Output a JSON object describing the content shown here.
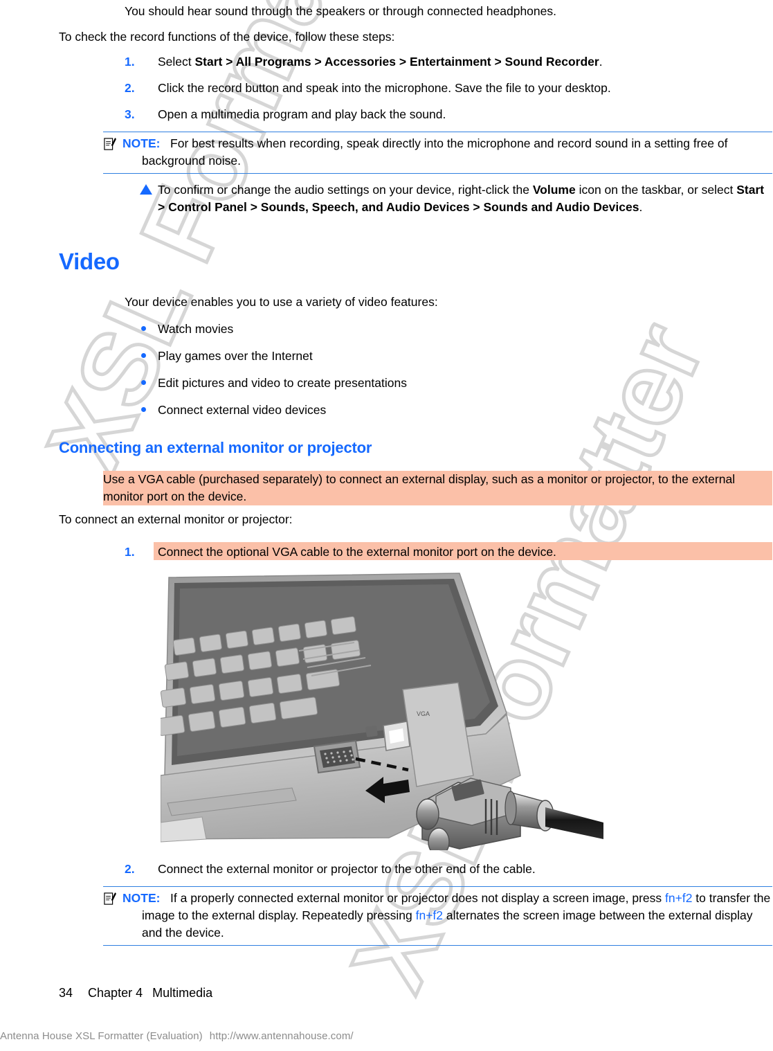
{
  "document": {
    "intro_line": "You should hear sound through the speakers or through connected headphones.",
    "record_steps_lead": "To check the record functions of the device, follow these steps:"
  },
  "record_steps": [
    {
      "num": "1.",
      "pre": "Select ",
      "bold": "Start > All Programs > Accessories > Entertainment > Sound Recorder",
      "post": "."
    },
    {
      "num": "2.",
      "pre": "Click the record button and speak into the microphone. Save the file to your desktop.",
      "bold": "",
      "post": ""
    },
    {
      "num": "3.",
      "pre": "Open a multimedia program and play back the sound.",
      "bold": "",
      "post": ""
    }
  ],
  "note_record": {
    "icon": "note-pencil-icon",
    "label": "NOTE:",
    "text": "For best results when recording, speak directly into the microphone and record sound in a setting free of background noise."
  },
  "audio_settings_step": {
    "bullet": "triangle-bullet",
    "part1": "To confirm or change the audio settings on your device, right-click the ",
    "bold1": "Volume",
    "part2": " icon on the taskbar, or select ",
    "bold2": "Start > Control Panel > Sounds, Speech, and Audio Devices > Sounds and Audio Devices",
    "part3": "."
  },
  "video_section": {
    "heading": "Video",
    "lead": "Your device enables you to use a variety of video features:",
    "features": [
      "Watch movies",
      "Play games over the Internet",
      "Edit pictures and video to create presentations",
      "Connect external video devices"
    ]
  },
  "monitor_section": {
    "heading": "Connecting an external monitor or projector",
    "highlighted_paragraph": "Use a VGA cable (purchased separately) to connect an external display, such as a monitor or projector, to the external monitor port on the device.",
    "lead": "To connect an external monitor or projector:",
    "steps": [
      {
        "num": "1.",
        "text": "Connect the optional VGA cable to the external monitor port on the device.",
        "highlighted": true
      },
      {
        "num": "2.",
        "text": "Connect the external monitor or projector to the other end of the cable.",
        "highlighted": false
      }
    ]
  },
  "figure": {
    "alt": "Netbook with external monitor VGA port and VGA cable connector being inserted, indicated by a dashed-line arrow"
  },
  "note_monitor": {
    "icon": "note-pencil-icon",
    "label": "NOTE:",
    "text_part1": "If a properly connected external monitor or projector does not display a screen image, press ",
    "key1": "fn+f2",
    "text_part2": " to transfer the image to the external display. Repeatedly pressing ",
    "key2": "fn+f2",
    "text_part3": " alternates the screen image between the external display and the device."
  },
  "footer": {
    "page_number": "34",
    "chapter": "Chapter 4",
    "title": "Multimedia"
  },
  "evaluation_banner": {
    "product": "Antenna House XSL Formatter (Evaluation)",
    "url": "http://www.antennahouse.com/"
  },
  "watermark": {
    "text": "XSL Formatter"
  },
  "colors": {
    "accent_blue": "#1569ff",
    "note_rule": "#2f7fe0",
    "highlight": "#fbc0a8",
    "watermark_gray": "#d6d6d6",
    "eval_gray": "#8c8c8c"
  }
}
